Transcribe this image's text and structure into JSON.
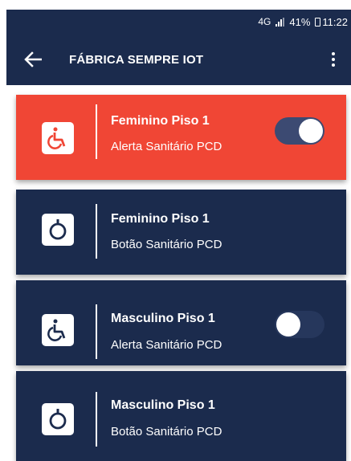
{
  "status_bar": {
    "network": "4G",
    "battery": "41%",
    "time": "11:22"
  },
  "app_bar": {
    "title": "FÁBRICA SEMPRE IOT",
    "back_icon": "arrow-left-icon",
    "menu_icon": "more-vert-icon"
  },
  "colors": {
    "primary": "#1b2b4d",
    "alert": "#f04635",
    "icon_accent_active": "#f04635",
    "icon_accent": "#1b2b4d"
  },
  "devices": [
    {
      "title": "Feminino Piso 1",
      "subtitle": "Alerta Sanitário PCD",
      "icon": "wheelchair-icon",
      "has_toggle": true,
      "toggle_on": true,
      "active": true
    },
    {
      "title": "Feminino Piso 1",
      "subtitle": "Botão Sanitário PCD",
      "icon": "pull-ring-icon",
      "has_toggle": false,
      "active": false
    },
    {
      "title": "Masculino Piso 1",
      "subtitle": "Alerta Sanitário PCD",
      "icon": "wheelchair-icon",
      "has_toggle": true,
      "toggle_on": false,
      "active": false
    },
    {
      "title": "Masculino Piso 1",
      "subtitle": "Botão Sanitário PCD",
      "icon": "pull-ring-icon",
      "has_toggle": false,
      "active": false
    }
  ]
}
